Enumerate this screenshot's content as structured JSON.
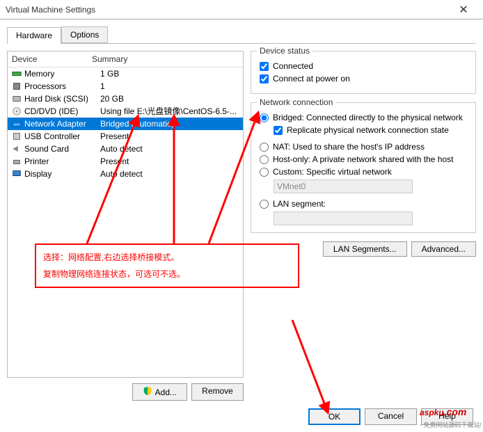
{
  "window": {
    "title": "Virtual Machine Settings"
  },
  "tabs": {
    "hardware": "Hardware",
    "options": "Options"
  },
  "list": {
    "head_device": "Device",
    "head_summary": "Summary",
    "rows": [
      {
        "device": "Memory",
        "summary": "1 GB",
        "icon": "memory"
      },
      {
        "device": "Processors",
        "summary": "1",
        "icon": "cpu"
      },
      {
        "device": "Hard Disk (SCSI)",
        "summary": "20 GB",
        "icon": "disk"
      },
      {
        "device": "CD/DVD (IDE)",
        "summary": "Using file E:\\光盘镜像\\CentOS-6.5-...",
        "icon": "cd"
      },
      {
        "device": "Network Adapter",
        "summary": "Bridged (Automatic)",
        "icon": "net",
        "selected": true
      },
      {
        "device": "USB Controller",
        "summary": "Present",
        "icon": "usb"
      },
      {
        "device": "Sound Card",
        "summary": "Auto detect",
        "icon": "sound"
      },
      {
        "device": "Printer",
        "summary": "Present",
        "icon": "printer"
      },
      {
        "device": "Display",
        "summary": "Auto detect",
        "icon": "display"
      }
    ]
  },
  "left_buttons": {
    "add": "Add...",
    "remove": "Remove"
  },
  "device_status": {
    "title": "Device status",
    "connected": "Connected",
    "connect_power": "Connect at power on"
  },
  "network": {
    "title": "Network connection",
    "bridged": "Bridged: Connected directly to the physical network",
    "replicate": "Replicate physical network connection state",
    "nat": "NAT: Used to share the host's IP address",
    "hostonly": "Host-only: A private network shared with the host",
    "custom": "Custom: Specific virtual network",
    "vmnet": "VMnet0",
    "lan": "LAN segment:"
  },
  "right_buttons": {
    "lan_seg": "LAN Segments...",
    "advanced": "Advanced..."
  },
  "bottom": {
    "ok": "OK",
    "cancel": "Cancel",
    "help": "Help"
  },
  "annotation": {
    "line1": "选择：网络配置,右边选择桥接模式。",
    "line2": "复制物理网络连接状态，可选可不选。"
  },
  "watermark": {
    "main": "aspku",
    "suffix": ".com",
    "sub": "- 免费网站源码下载站!"
  }
}
